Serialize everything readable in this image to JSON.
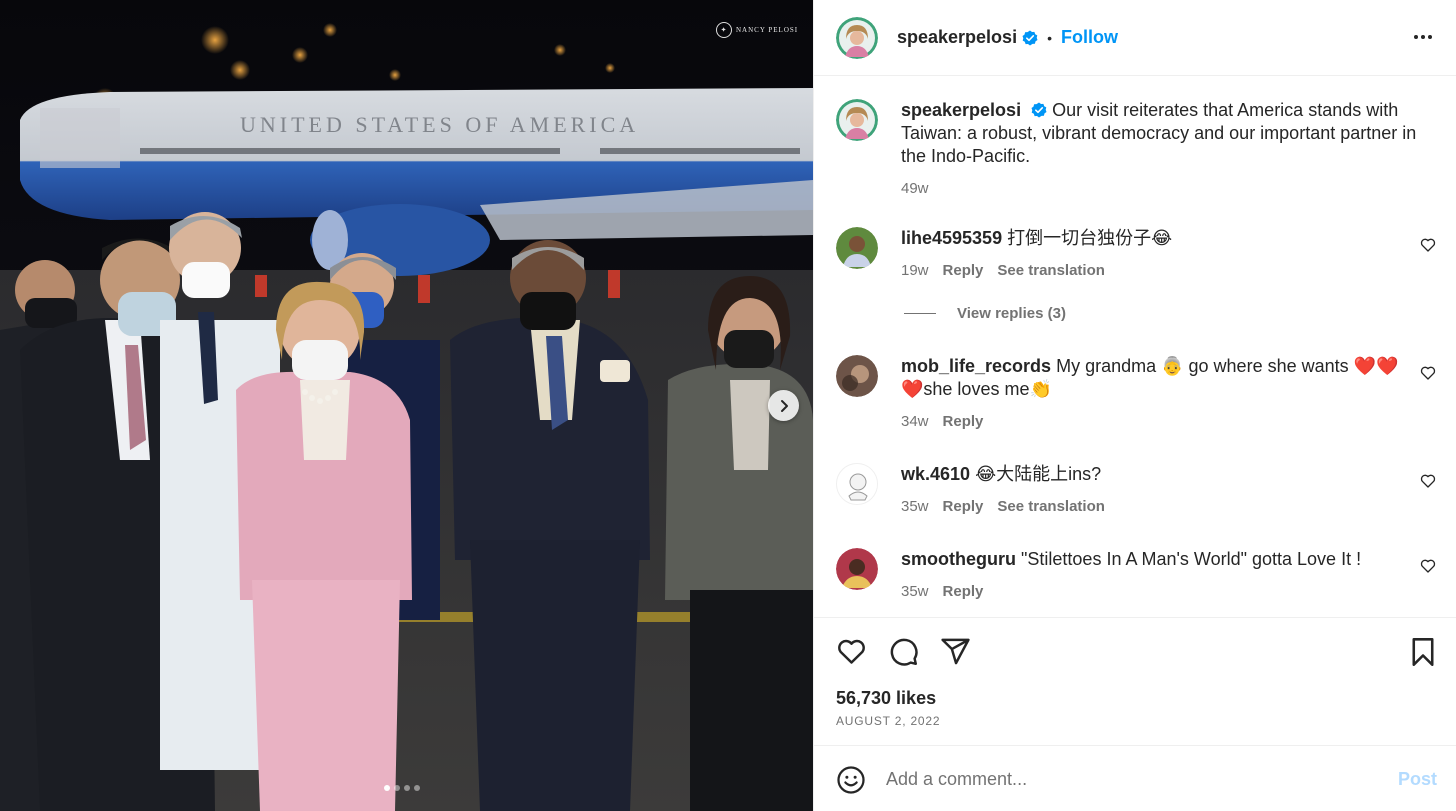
{
  "photo": {
    "watermark_text": "NANCY PELOSI",
    "plane_text": "UNITED STATES OF AMERICA",
    "next_icon": "chevron-right-icon",
    "carousel_count": 4,
    "carousel_active": 1
  },
  "header": {
    "username": "speakerpelosi",
    "separator": "•",
    "follow_label": "Follow",
    "more_icon": "more-horizontal-icon"
  },
  "caption": {
    "username": "speakerpelosi",
    "text": "Our visit reiterates that America stands with Taiwan: a robust, vibrant democracy and our important partner in the Indo-Pacific.",
    "time": "49w"
  },
  "comments": [
    {
      "username": "lihe4595359",
      "text": "打倒一切台独份子😂",
      "time": "19w",
      "reply_label": "Reply",
      "translation_label": "See translation"
    },
    {
      "username": "mob_life_records",
      "text": "My grandma 👵 go where she wants ❤️❤️❤️she loves me👏",
      "time": "34w",
      "reply_label": "Reply"
    },
    {
      "username": "wk.4610",
      "text": "😂大陆能上ins?",
      "time": "35w",
      "reply_label": "Reply",
      "translation_label": "See translation"
    },
    {
      "username": "smootheguru",
      "text": "\"Stilettoes In A Man's World\" gotta Love It !",
      "time": "35w",
      "reply_label": "Reply"
    }
  ],
  "view_replies": "View replies (3)",
  "actions": {
    "like_icon": "heart-icon",
    "comment_icon": "comment-icon",
    "share_icon": "share-icon",
    "save_icon": "bookmark-icon",
    "likes": "56,730 likes",
    "date": "AUGUST 2, 2022"
  },
  "add_comment": {
    "placeholder": "Add a comment...",
    "post_label": "Post",
    "emoji_icon": "smile-icon"
  },
  "colors": {
    "accent": "#0095f6",
    "post_disabled": "#b3dbff",
    "secondary_text": "#737373",
    "verified": "#0095f6"
  }
}
